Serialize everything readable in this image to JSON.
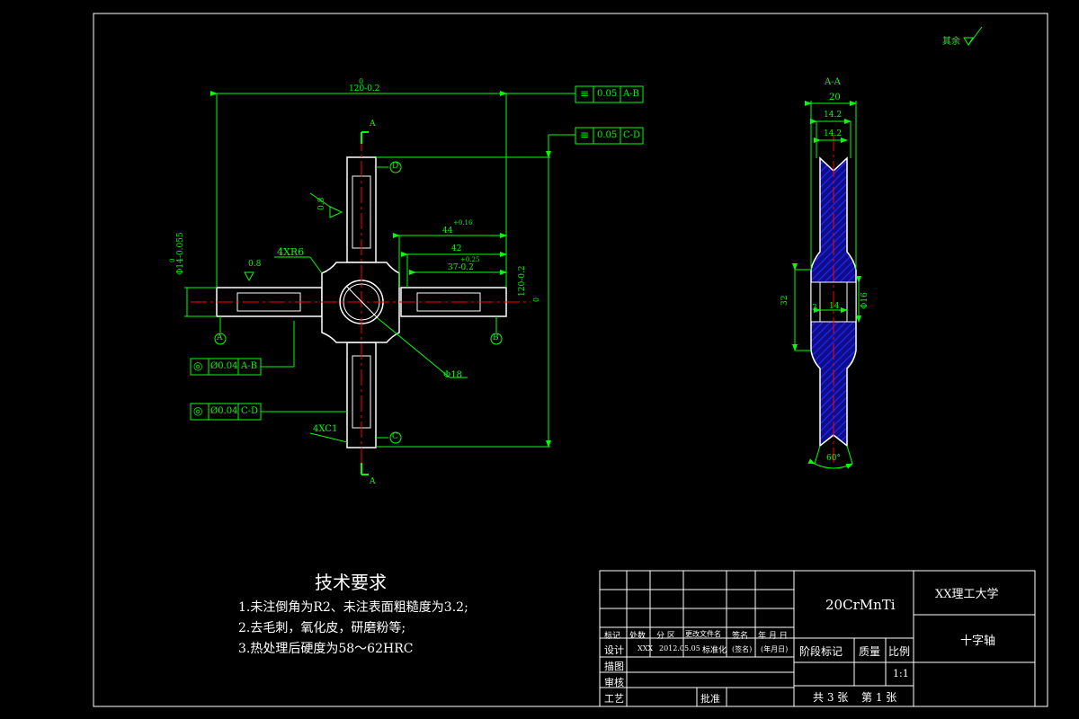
{
  "part": {
    "view_title": "A-A",
    "surface_finish": "其余",
    "section_label_top": "A",
    "section_label_bottom": "A"
  },
  "front_view": {
    "dim_overall_width": "120-0.2",
    "dim_overall_width_tol": "0",
    "dim_overall_height": "120-0.2",
    "dim_overall_height_tol": "0",
    "dim_44": "44",
    "dim_44_tol": "+0.16",
    "dim_42": "42",
    "dim_37": "37-0.2",
    "dim_37_tol": "+0.25",
    "dim_journal": "Φ14-0.055",
    "dim_journal_tol": "0",
    "dim_hole": "Φ18",
    "dim_fillet": "4XR6",
    "dim_chamfer": "4XC1",
    "rough_08_a": "0.8",
    "rough_08_b": "0.8",
    "datum_a": "A",
    "datum_b": "B",
    "datum_c": "C",
    "datum_d": "D",
    "tol_sym_ab": {
      "symbol": "≡",
      "value": "0.05",
      "datum": "A-B"
    },
    "tol_sym_cd": {
      "symbol": "≡",
      "value": "0.05",
      "datum": "C-D"
    },
    "tol_coax_ab": {
      "symbol": "◎",
      "value": "Ø0.04",
      "datum": "A-B"
    },
    "tol_coax_cd": {
      "symbol": "◎",
      "value": "Ø0.04",
      "datum": "C-D"
    }
  },
  "section_view": {
    "dim_20": "20",
    "dim_142_a": "14.2",
    "dim_142_b": "14.2",
    "dim_32": "32",
    "dim_3": "3",
    "dim_14": "14",
    "dim_phi16": "Φ16",
    "dim_angle": "60°"
  },
  "tech_requirements": {
    "title": "技术要求",
    "items": [
      "1.未注倒角为R2、未注表面粗糙度为3.2;",
      "2.去毛刺，氧化皮，研磨粉等;",
      "3.热处理后硬度为58～62HRC"
    ]
  },
  "title_block": {
    "material": "20CrMnTi",
    "school": "XX理工大学",
    "part_name": "十字轴",
    "header_labels": [
      "标记",
      "处数",
      "分 区",
      "更改文件名",
      "签名",
      "年 月 日"
    ],
    "design_row": [
      "设计",
      "XXX",
      "2012.05.05",
      "标准化",
      "(签名)",
      "(年月日)"
    ],
    "draw_label": "描图",
    "check_label": "审核",
    "process_label": "工艺",
    "approve_label": "批准",
    "stage_label": "阶段标记",
    "weight_label": "质量",
    "scale_label": "比例",
    "scale_value": "1:1",
    "sheets_total": "共 3 张",
    "sheet_no": "第 1 张"
  },
  "colors": {
    "background": "#000000",
    "outline": "#ffffff",
    "dimension": "#00ff00",
    "centerline": "#ff0000",
    "hatch": "#0000ff"
  }
}
